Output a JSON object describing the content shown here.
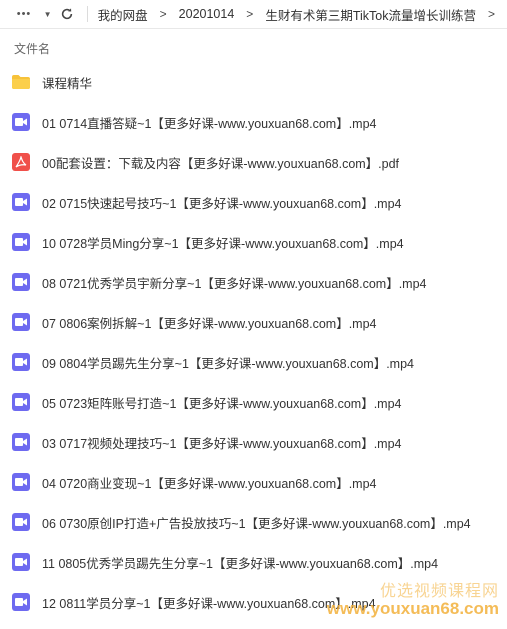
{
  "toolbar": {
    "more": "•••",
    "down": "▼",
    "breadcrumbs": [
      "我的网盘",
      "20201014",
      "生财有术第三期TikTok流量增长训练营"
    ],
    "sep": ">",
    "overflow": ">"
  },
  "list_header": {
    "name_column": "文件名"
  },
  "files": [
    {
      "type": "folder",
      "name": "课程精华"
    },
    {
      "type": "video",
      "name": "01 0714直播答疑~1【更多好课-www.youxuan68.com】.mp4"
    },
    {
      "type": "pdf",
      "name": "00配套设置：下载及内容【更多好课-www.youxuan68.com】.pdf"
    },
    {
      "type": "video",
      "name": "02 0715快速起号技巧~1【更多好课-www.youxuan68.com】.mp4"
    },
    {
      "type": "video",
      "name": "10 0728学员Ming分享~1【更多好课-www.youxuan68.com】.mp4"
    },
    {
      "type": "video",
      "name": "08 0721优秀学员宇新分享~1【更多好课-www.youxuan68.com】.mp4"
    },
    {
      "type": "video",
      "name": "07 0806案例拆解~1【更多好课-www.youxuan68.com】.mp4"
    },
    {
      "type": "video",
      "name": "09 0804学员踢先生分享~1【更多好课-www.youxuan68.com】.mp4"
    },
    {
      "type": "video",
      "name": "05 0723矩阵账号打造~1【更多好课-www.youxuan68.com】.mp4"
    },
    {
      "type": "video",
      "name": "03 0717视频处理技巧~1【更多好课-www.youxuan68.com】.mp4"
    },
    {
      "type": "video",
      "name": "04 0720商业变现~1【更多好课-www.youxuan68.com】.mp4"
    },
    {
      "type": "video",
      "name": "06 0730原创IP打造+广告投放技巧~1【更多好课-www.youxuan68.com】.mp4"
    },
    {
      "type": "video",
      "name": "11 0805优秀学员踢先生分享~1【更多好课-www.youxuan68.com】.mp4"
    },
    {
      "type": "video",
      "name": "12 0811学员分享~1【更多好课-www.youxuan68.com】.mp4"
    }
  ],
  "watermark": {
    "cn": "优选视频课程网",
    "url": "www.youxuan68.com"
  },
  "colors": {
    "folder": "#f7c23a",
    "video": "#6e6af0",
    "pdf": "#f0504a"
  }
}
